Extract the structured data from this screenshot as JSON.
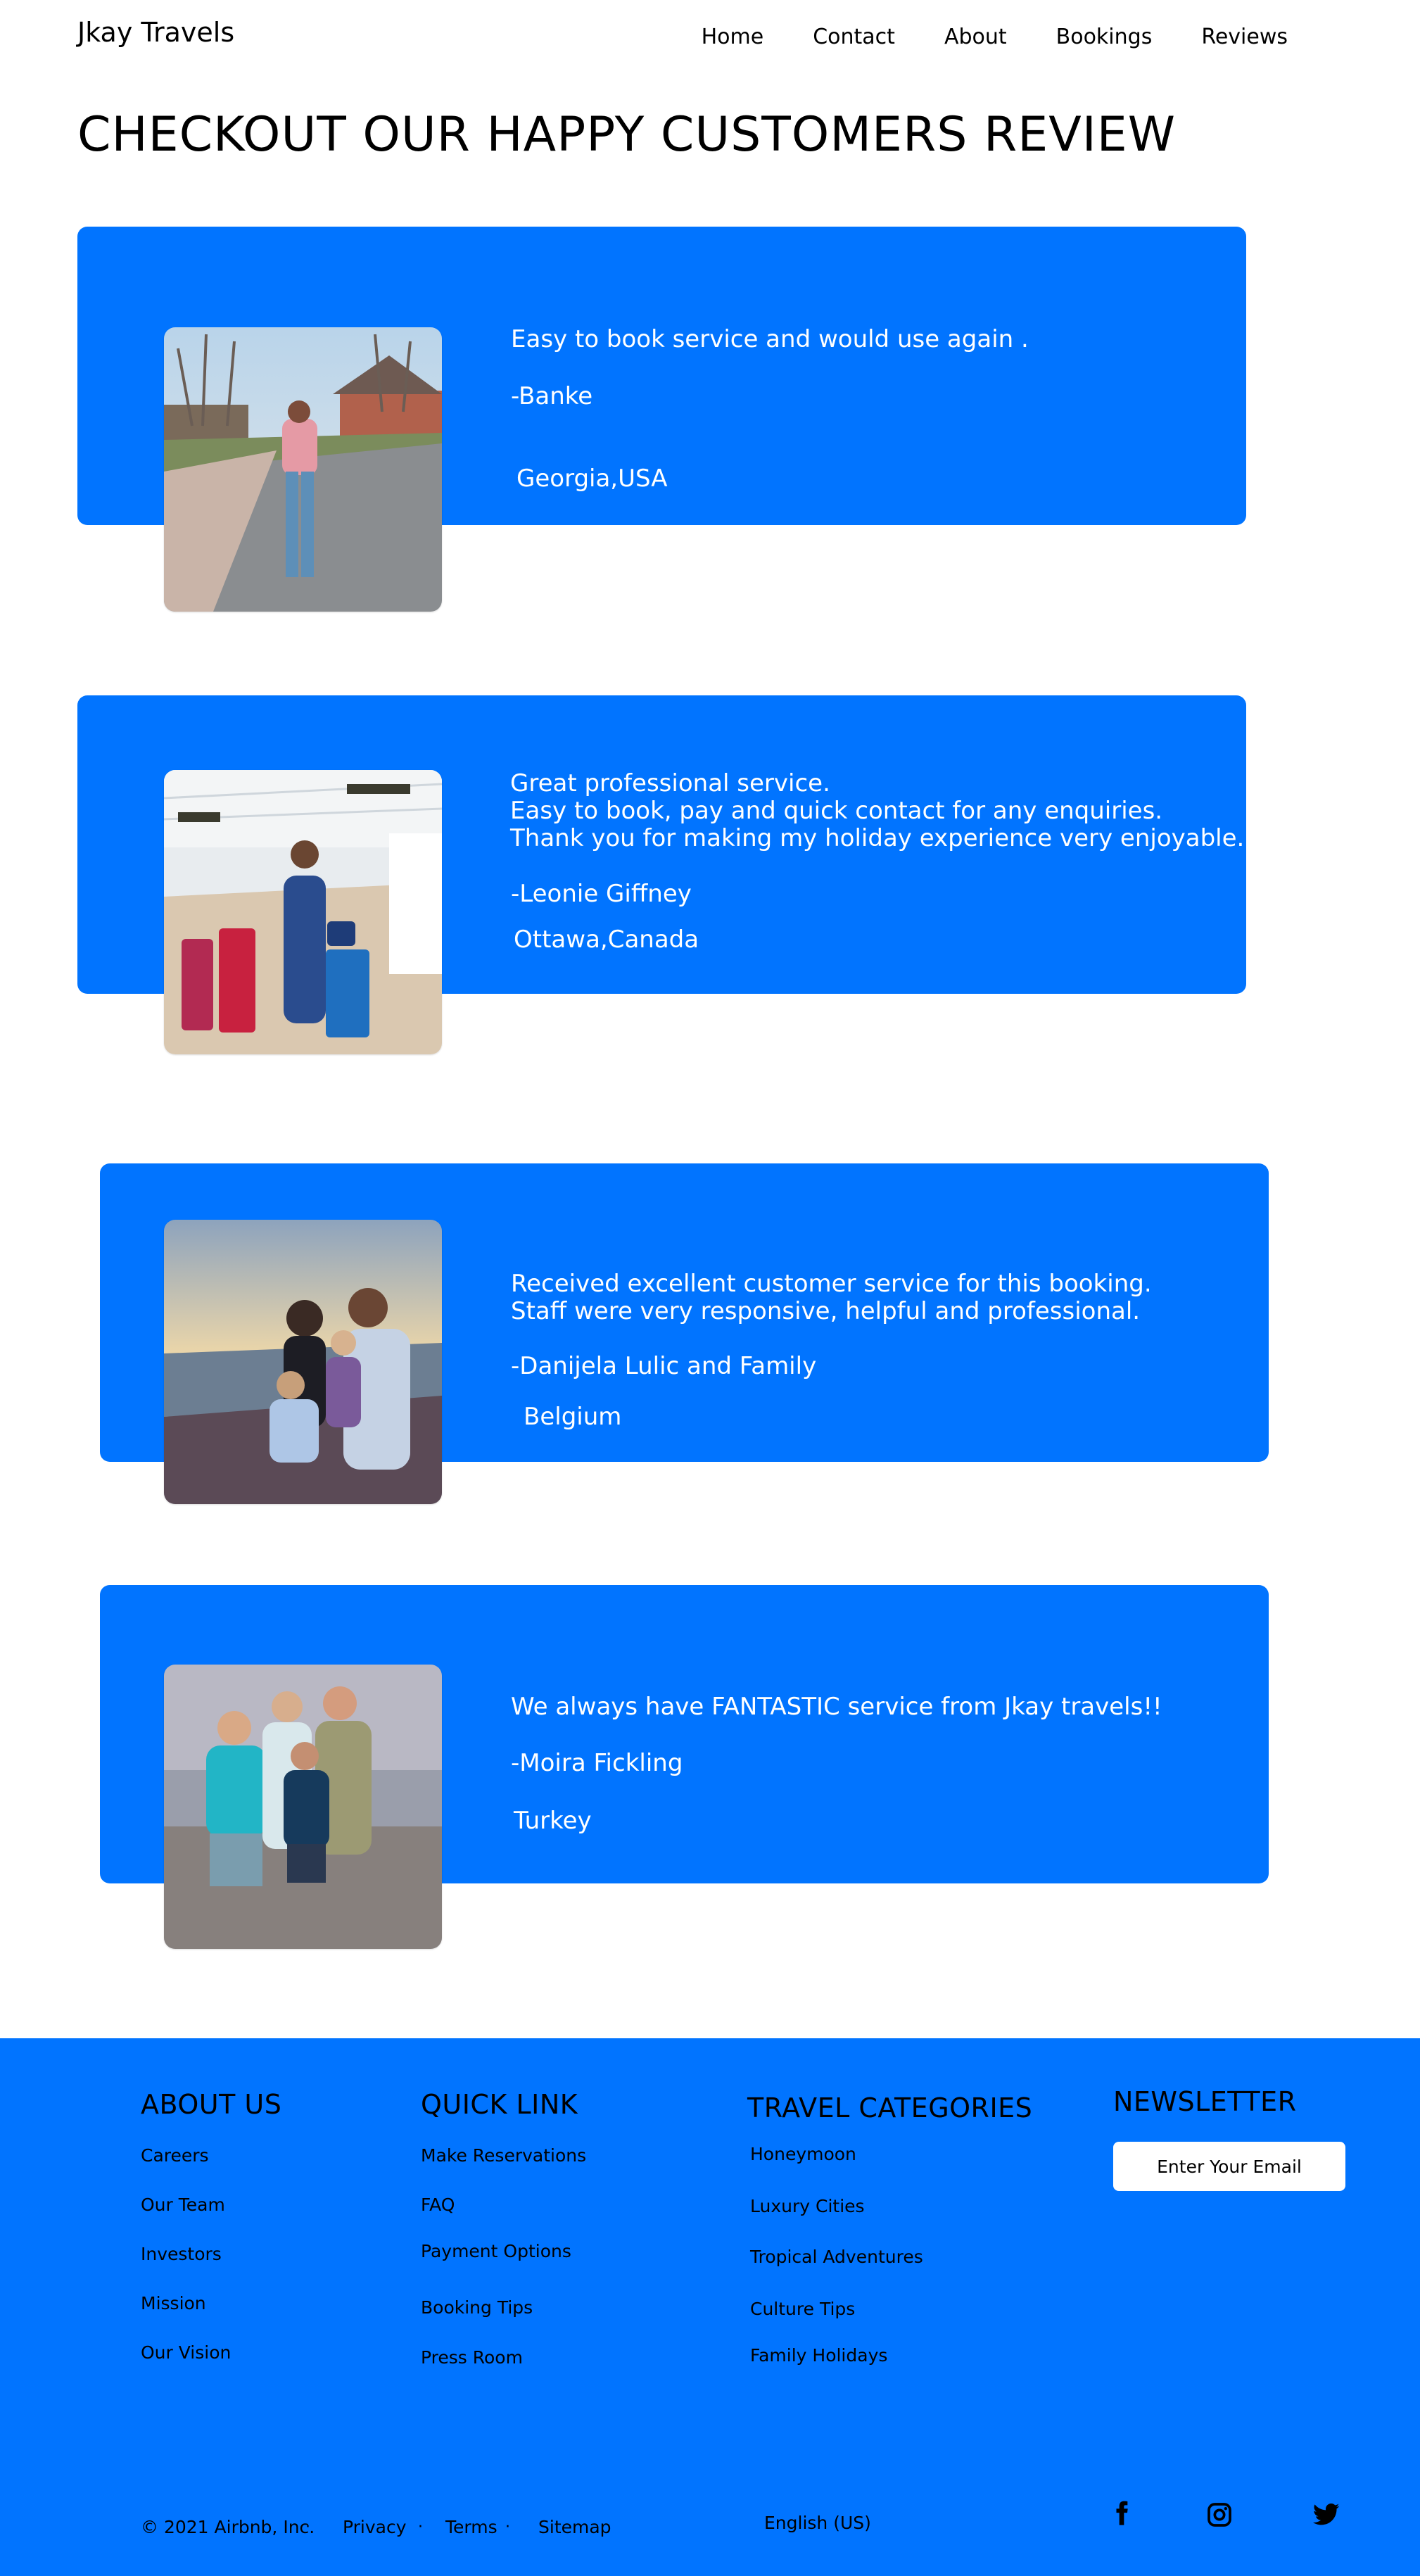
{
  "header": {
    "brand": "Jkay Travels",
    "nav": [
      "Home",
      "Contact",
      "About",
      "Bookings",
      "Reviews"
    ]
  },
  "section_title": "CHECKOUT OUR HAPPY CUSTOMERS REVIEW",
  "reviews": [
    {
      "lines": [
        "Easy to book service and would use again ."
      ],
      "reviewer": "-Banke",
      "location": "Georgia,USA"
    },
    {
      "lines": [
        "Great professional service.",
        "Easy to book, pay and quick contact for any enquiries.",
        "Thank you for making my holiday experience very enjoyable."
      ],
      "reviewer": "-Leonie Giffney",
      "location": "Ottawa,Canada"
    },
    {
      "lines": [
        "Received excellent customer service for this booking.",
        "Staff were very responsive, helpful and professional."
      ],
      "reviewer": "-Danijela Lulic  and Family",
      "location": "Belgium"
    },
    {
      "lines": [
        "We always have FANTASTIC service from Jkay travels!!"
      ],
      "reviewer": "-Moira Fickling",
      "location": "Turkey"
    }
  ],
  "footer": {
    "about": {
      "title": "ABOUT US",
      "links": [
        "Careers",
        "Our Team",
        "Investors",
        "Mission",
        "Our Vision"
      ]
    },
    "quick": {
      "title": "QUICK LINK",
      "links": [
        "Make Reservations",
        "FAQ",
        "Payment Options",
        "Booking Tips",
        "Press Room"
      ]
    },
    "travel": {
      "title": "TRAVEL CATEGORIES",
      "links": [
        "Honeymoon",
        "Luxury Cities",
        "Tropical Adventures",
        "Culture Tips",
        "Family Holidays"
      ]
    },
    "newsletter": {
      "title": "NEWSLETTER",
      "placeholder": "Enter Your Email"
    },
    "bottom": {
      "copyright": "© 2021 Airbnb, Inc.",
      "privacy": "Privacy",
      "terms": "Terms",
      "sitemap": "Sitemap",
      "language": "English (US)",
      "separator": "·"
    },
    "social_icons": [
      "facebook-icon",
      "instagram-icon",
      "twitter-icon"
    ]
  },
  "colors": {
    "accent": "#0174ff",
    "text": "#000000",
    "card_text": "#ffffff"
  }
}
